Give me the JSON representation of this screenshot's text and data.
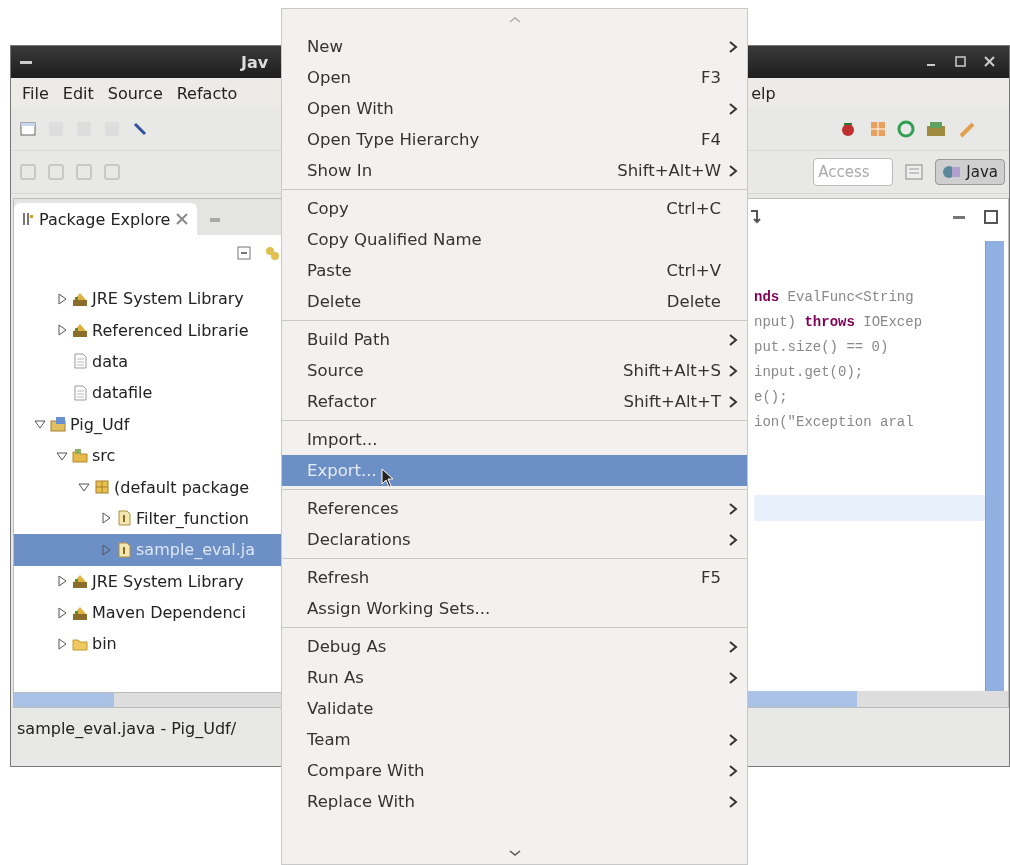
{
  "window": {
    "title": "Jav"
  },
  "menu_bar": [
    {
      "label": "File"
    },
    {
      "label": "Edit"
    },
    {
      "label": "Source"
    },
    {
      "label": "Refacto"
    },
    {
      "label": "elp"
    }
  ],
  "quick_access": {
    "placeholder": "Access"
  },
  "perspective_button": {
    "label": "Java",
    "selected": true
  },
  "package_explorer": {
    "tab_label": "Package Explore",
    "orphan_rows": [
      {
        "label": "JRE System Library",
        "kind": "library",
        "expanded": false,
        "selected": false
      },
      {
        "label": "Referenced Librarie",
        "kind": "library",
        "expanded": false,
        "selected": false
      },
      {
        "label": "data",
        "kind": "file",
        "selected": false
      },
      {
        "label": "datafile",
        "kind": "file",
        "selected": false
      }
    ],
    "items": [
      {
        "label": "Pig_Udf",
        "kind": "project",
        "expanded": true,
        "selected": false,
        "children": [
          {
            "label": "src",
            "kind": "source-folder",
            "expanded": true,
            "selected": false,
            "children": [
              {
                "label": "(default package",
                "kind": "package",
                "expanded": true,
                "selected": false,
                "children": [
                  {
                    "label": "Filter_function",
                    "kind": "java-file",
                    "expanded": false,
                    "selected": false
                  },
                  {
                    "label": "sample_eval.ja",
                    "kind": "java-file",
                    "expanded": false,
                    "selected": true
                  }
                ]
              }
            ]
          },
          {
            "label": "JRE System Library",
            "kind": "library",
            "expanded": false,
            "selected": false
          },
          {
            "label": "Maven Dependenci",
            "kind": "library",
            "expanded": false,
            "selected": false
          },
          {
            "label": "bin",
            "kind": "folder",
            "expanded": false,
            "selected": false
          }
        ]
      }
    ]
  },
  "editor": {
    "code_lines": [
      {
        "text": "**nds** EvalFunc<String"
      },
      {
        "text": "nput) **throws** IOExcep"
      },
      {
        "text": "put.size() == 0)"
      },
      {
        "text": "input.get(0);"
      },
      {
        "text": "e();"
      },
      {
        "text": "ion(\"Exception aral"
      }
    ]
  },
  "status_bar": {
    "text": "sample_eval.java - Pig_Udf/"
  },
  "context_menu": {
    "groups": [
      [
        {
          "label": "New",
          "submenu": true,
          "selected": false
        },
        {
          "label": "Open",
          "shortcut": "F3",
          "submenu": false,
          "selected": false
        },
        {
          "label": "Open With",
          "submenu": true,
          "selected": false
        },
        {
          "label": "Open Type Hierarchy",
          "shortcut": "F4",
          "submenu": false,
          "selected": false
        },
        {
          "label": "Show In",
          "shortcut": "Shift+Alt+W",
          "submenu": true,
          "selected": false
        }
      ],
      [
        {
          "label": "Copy",
          "shortcut": "Ctrl+C",
          "submenu": false,
          "selected": false
        },
        {
          "label": "Copy Qualified Name",
          "submenu": false,
          "selected": false
        },
        {
          "label": "Paste",
          "shortcut": "Ctrl+V",
          "submenu": false,
          "selected": false
        },
        {
          "label": "Delete",
          "shortcut": "Delete",
          "submenu": false,
          "selected": false
        }
      ],
      [
        {
          "label": "Build Path",
          "submenu": true,
          "selected": false
        },
        {
          "label": "Source",
          "shortcut": "Shift+Alt+S",
          "submenu": true,
          "selected": false
        },
        {
          "label": "Refactor",
          "shortcut": "Shift+Alt+T",
          "submenu": true,
          "selected": false
        }
      ],
      [
        {
          "label": "Import...",
          "submenu": false,
          "selected": false
        },
        {
          "label": "Export...",
          "submenu": false,
          "selected": true
        }
      ],
      [
        {
          "label": "References",
          "submenu": true,
          "selected": false
        },
        {
          "label": "Declarations",
          "submenu": true,
          "selected": false
        }
      ],
      [
        {
          "label": "Refresh",
          "shortcut": "F5",
          "submenu": false,
          "selected": false
        },
        {
          "label": "Assign Working Sets...",
          "submenu": false,
          "selected": false
        }
      ],
      [
        {
          "label": "Debug As",
          "submenu": true,
          "selected": false
        },
        {
          "label": "Run As",
          "submenu": true,
          "selected": false
        },
        {
          "label": "Validate",
          "submenu": false,
          "selected": false
        },
        {
          "label": "Team",
          "submenu": true,
          "selected": false
        },
        {
          "label": "Compare With",
          "submenu": true,
          "selected": false
        },
        {
          "label": "Replace With",
          "submenu": true,
          "selected": false
        }
      ]
    ]
  }
}
